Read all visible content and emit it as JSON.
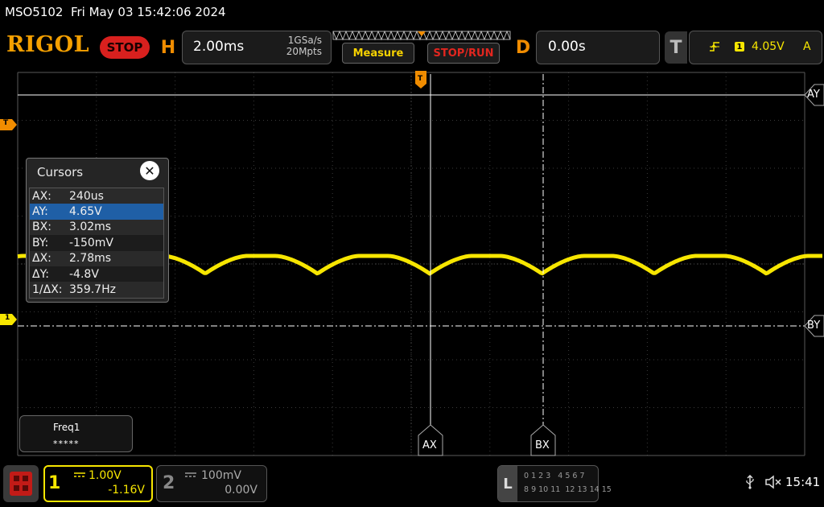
{
  "title_line": "MSO5102  Fri May 03 15:42:06 2024",
  "header": {
    "logo": "RIGOL",
    "run_state": "STOP",
    "horizontal": {
      "key": "H",
      "timebase": "2.00ms",
      "sample_rate": "1GSa/s",
      "memory_depth": "20Mpts"
    },
    "buttons": {
      "measure": "Measure",
      "stop_run": "STOP/RUN"
    },
    "delay": {
      "key": "D",
      "value": "0.00s"
    },
    "trigger": {
      "key": "T",
      "source": "1",
      "level": "4.05V",
      "mode": "A"
    }
  },
  "markers": {
    "trigger_left": "T",
    "ch1_ground": "1",
    "trigger_top": "T"
  },
  "cursors": {
    "title": "Cursors",
    "rows": [
      {
        "key": "AX:",
        "value": "240us"
      },
      {
        "key": "AY:",
        "value": "4.65V",
        "selected": true
      },
      {
        "key": "BX:",
        "value": "3.02ms"
      },
      {
        "key": "BY:",
        "value": "-150mV"
      },
      {
        "key": "ΔX:",
        "value": "2.78ms"
      },
      {
        "key": "ΔY:",
        "value": "-4.8V"
      },
      {
        "key": "1/ΔX:",
        "value": "359.7Hz"
      }
    ],
    "labels": {
      "ay": "AY",
      "by": "BY",
      "ax": "AX",
      "bx": "BX"
    }
  },
  "measurement": {
    "name": "Freq1",
    "value": "*****"
  },
  "channels": [
    {
      "num": "1",
      "scale": "1.00V",
      "offset": "-1.16V",
      "active": true,
      "color": "#f7e600"
    },
    {
      "num": "2",
      "scale": "100mV",
      "offset": "0.00V",
      "active": false,
      "color": "#888888"
    }
  ],
  "logic": {
    "key": "L",
    "row1": "0 1 2 3   4 5 6 7",
    "row2": "8 9 10 11  12 13 14 15"
  },
  "status": {
    "time": "15:41",
    "usb_icon": "usb-icon",
    "mute_icon": "speaker-muted-icon"
  },
  "colors": {
    "accent": "#f08c00",
    "ch1": "#f7e600",
    "stop": "#d8201e",
    "selection": "#1f5fa6"
  }
}
